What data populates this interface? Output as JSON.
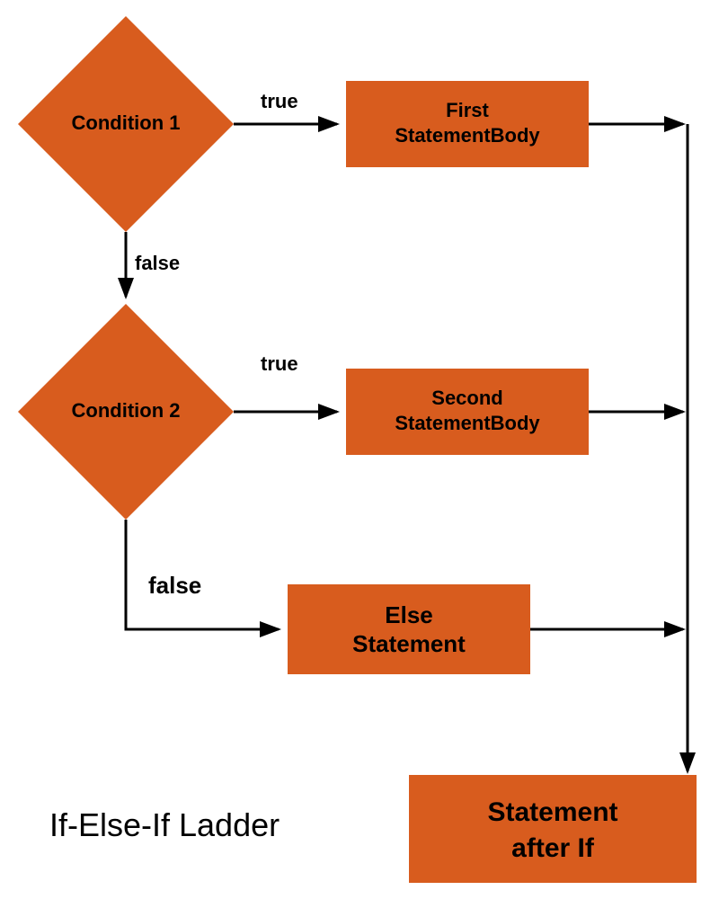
{
  "diagram": {
    "title": "If-Else-If Ladder",
    "nodes": {
      "cond1": "Condition 1",
      "cond2": "Condition 2",
      "stmt1_l1": "First",
      "stmt1_l2": "StatementBody",
      "stmt2_l1": "Second",
      "stmt2_l2": "StatementBody",
      "else_l1": "Else",
      "else_l2": "Statement",
      "after_l1": "Statement",
      "after_l2": "after If"
    },
    "labels": {
      "true1": "true",
      "false1": "false",
      "true2": "true",
      "false2": "false"
    },
    "colors": {
      "node": "#d85c1e",
      "line": "#000000"
    }
  }
}
